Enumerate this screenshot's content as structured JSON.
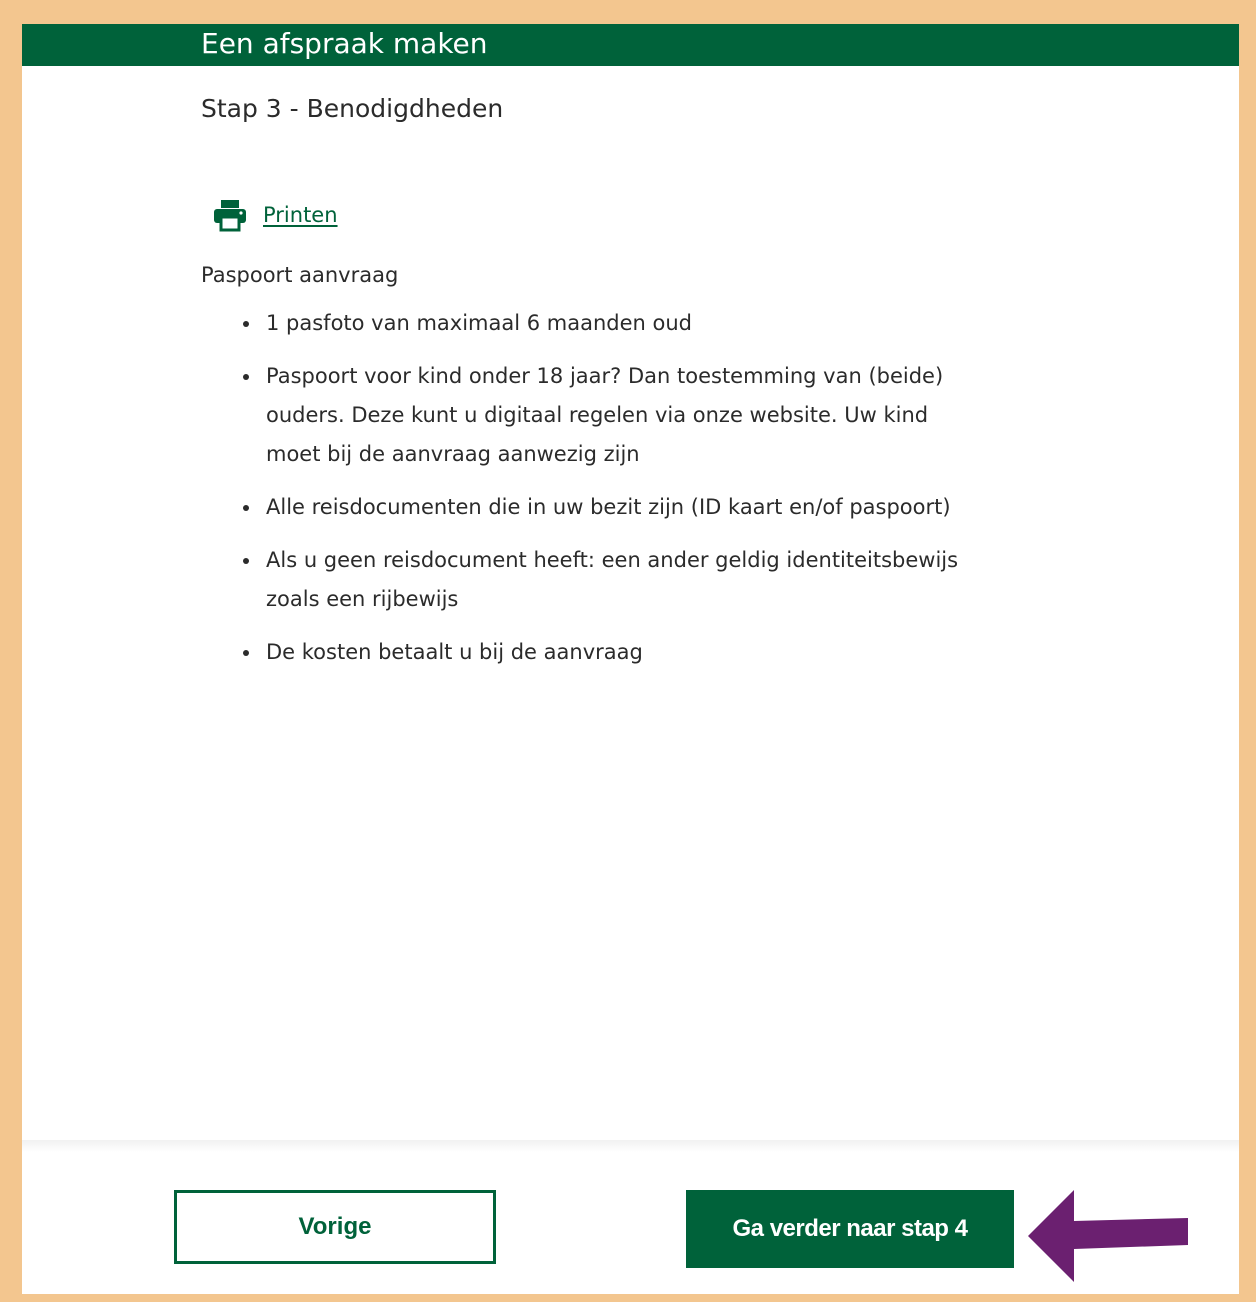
{
  "header": {
    "title": "Een afspraak maken"
  },
  "step": {
    "title": "Stap 3 - Benodigdheden"
  },
  "print": {
    "icon": "printer-icon",
    "label": "Printen"
  },
  "requirements": {
    "title": "Paspoort aanvraag",
    "items": [
      "1 pasfoto van maximaal 6 maanden oud",
      "Paspoort voor kind onder 18 jaar? Dan toestemming van (beide) ouders. Deze kunt u digitaal regelen via onze website. Uw kind moet bij de aanvraag aanwezig zijn",
      "Alle reisdocumenten die in uw bezit zijn (ID kaart en/of paspoort)",
      "Als u geen reisdocument heeft: een ander geldig identiteitsbewijs zoals een rijbewijs",
      "De kosten betaalt u bij de aanvraag"
    ]
  },
  "buttons": {
    "previous": "Vorige",
    "next": "Ga verder naar stap 4"
  },
  "colors": {
    "brand_green": "#00623a",
    "frame_border": "#f3c68f",
    "arrow": "#6b2070"
  }
}
